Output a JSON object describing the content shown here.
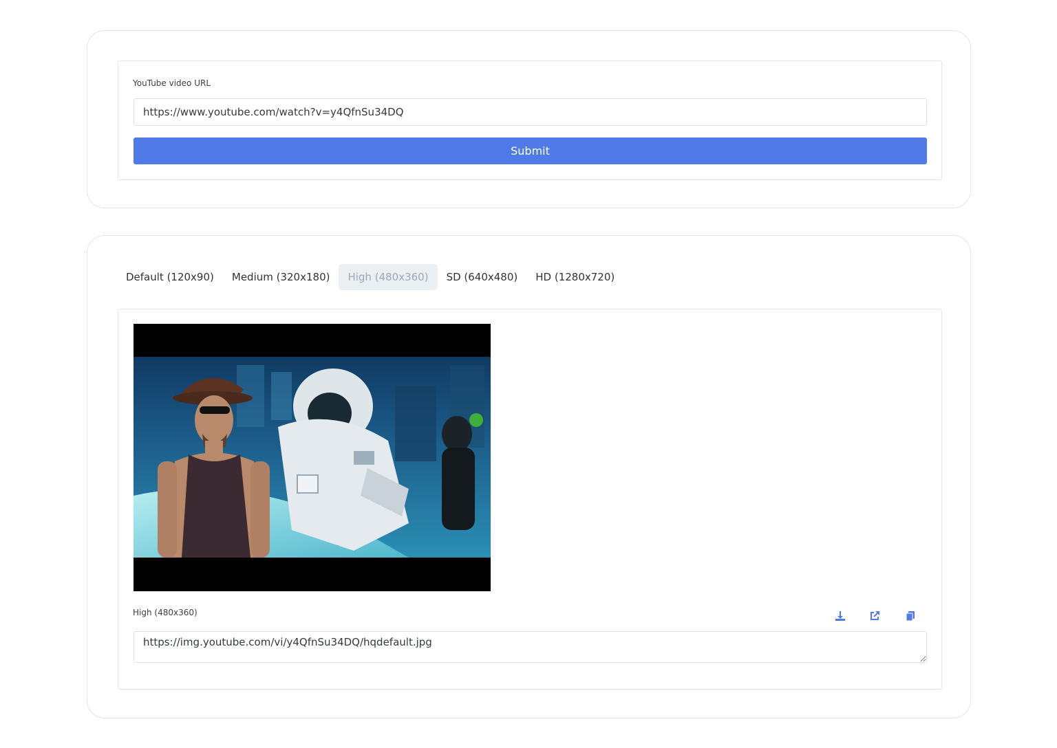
{
  "form": {
    "label": "YouTube video URL",
    "url_value": "https://www.youtube.com/watch?v=y4QfnSu34DQ",
    "submit_label": "Submit"
  },
  "tabs": [
    {
      "label": "Default (120x90)",
      "active": false
    },
    {
      "label": "Medium (320x180)",
      "active": false
    },
    {
      "label": "High (480x360)",
      "active": true
    },
    {
      "label": "SD (640x480)",
      "active": false
    },
    {
      "label": "HD (1280x720)",
      "active": false
    }
  ],
  "result": {
    "label": "High (480x360)",
    "image_url": "https://img.youtube.com/vi/y4QfnSu34DQ/hqdefault.jpg",
    "actions": [
      {
        "icon": "download-icon"
      },
      {
        "icon": "external-link-icon"
      },
      {
        "icon": "copy-icon"
      }
    ]
  },
  "colors": {
    "primary": "#4f7ae8",
    "border": "#e3e6ea",
    "active_tab_bg": "#eceff2",
    "active_tab_text": "#9aa8b8"
  }
}
